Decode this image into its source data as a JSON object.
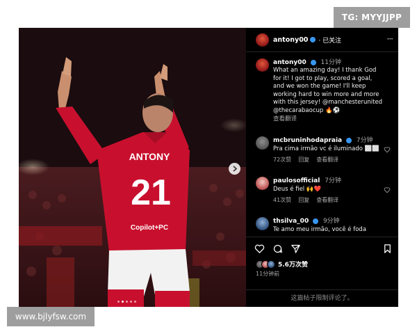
{
  "watermark_top": "TG: MYYJJPP",
  "watermark_bottom": "www.bjlyfsw.com",
  "photo": {
    "shirt_name": "ANTONY",
    "shirt_number": "21",
    "sponsor": "Copilot+PC",
    "carousel_dots": 5,
    "active_dot": 2
  },
  "header": {
    "username": "antony00",
    "follow_label": "· 已关注",
    "more_label": "···"
  },
  "post": {
    "username": "antony00",
    "time": "11分钟",
    "caption_lines": [
      "What an amazing day! I thank God",
      "for it! I got to play, scored a goal,",
      "and we won the game! I'll keep",
      "working hard to win more and more",
      "with this jersey! @manchesterunited",
      "@thecarabaocup 🔥⚽"
    ],
    "translate_label": "查看翻译"
  },
  "comments": [
    {
      "username": "mcbruninhodapraia",
      "time": "7分钟",
      "text": "Pra cima irmão vc é iluminado ⬜⬜",
      "likes": "72次赞",
      "reply_label": "回复",
      "translate_label": "查看翻译"
    },
    {
      "username": "paulosofficial",
      "time": "7分钟",
      "text": "Deus é fiel 🙌❤️",
      "likes": "41次赞",
      "reply_label": "回复",
      "translate_label": "查看翻译"
    },
    {
      "username": "thsilva_00",
      "time": "9分钟",
      "text": "Te amo meu irmão, você é foda"
    }
  ],
  "actions": {
    "likes_text": "5.6万次赞",
    "post_time": "11分钟前"
  },
  "footer": {
    "text": "这篇帖子限制评论了。"
  },
  "colors": {
    "accent": "#3897f0",
    "jersey": "#c8102e",
    "panel_bg": "#000000"
  }
}
